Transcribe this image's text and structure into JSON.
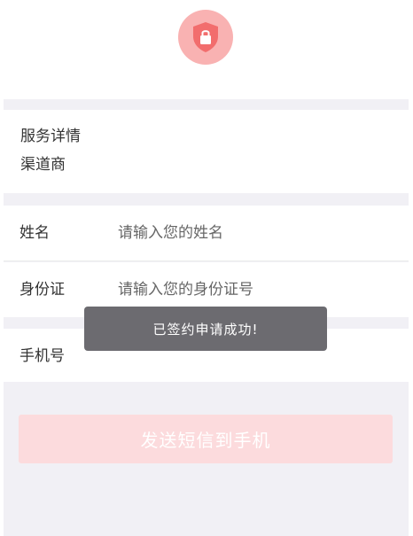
{
  "header": {
    "icon": "shield-lock-icon",
    "accent_color": "#f26d6d"
  },
  "service": {
    "title": "服务详情",
    "subtitle": "渠道商"
  },
  "form": {
    "name_label": "姓名",
    "name_placeholder": "请输入您的姓名",
    "id_label": "身份证",
    "id_placeholder": "请输入您的身份证号",
    "phone_label": "手机号",
    "phone_placeholder": ""
  },
  "actions": {
    "send_sms_label": "发送短信到手机"
  },
  "toast": {
    "message": "已签约申请成功!"
  }
}
